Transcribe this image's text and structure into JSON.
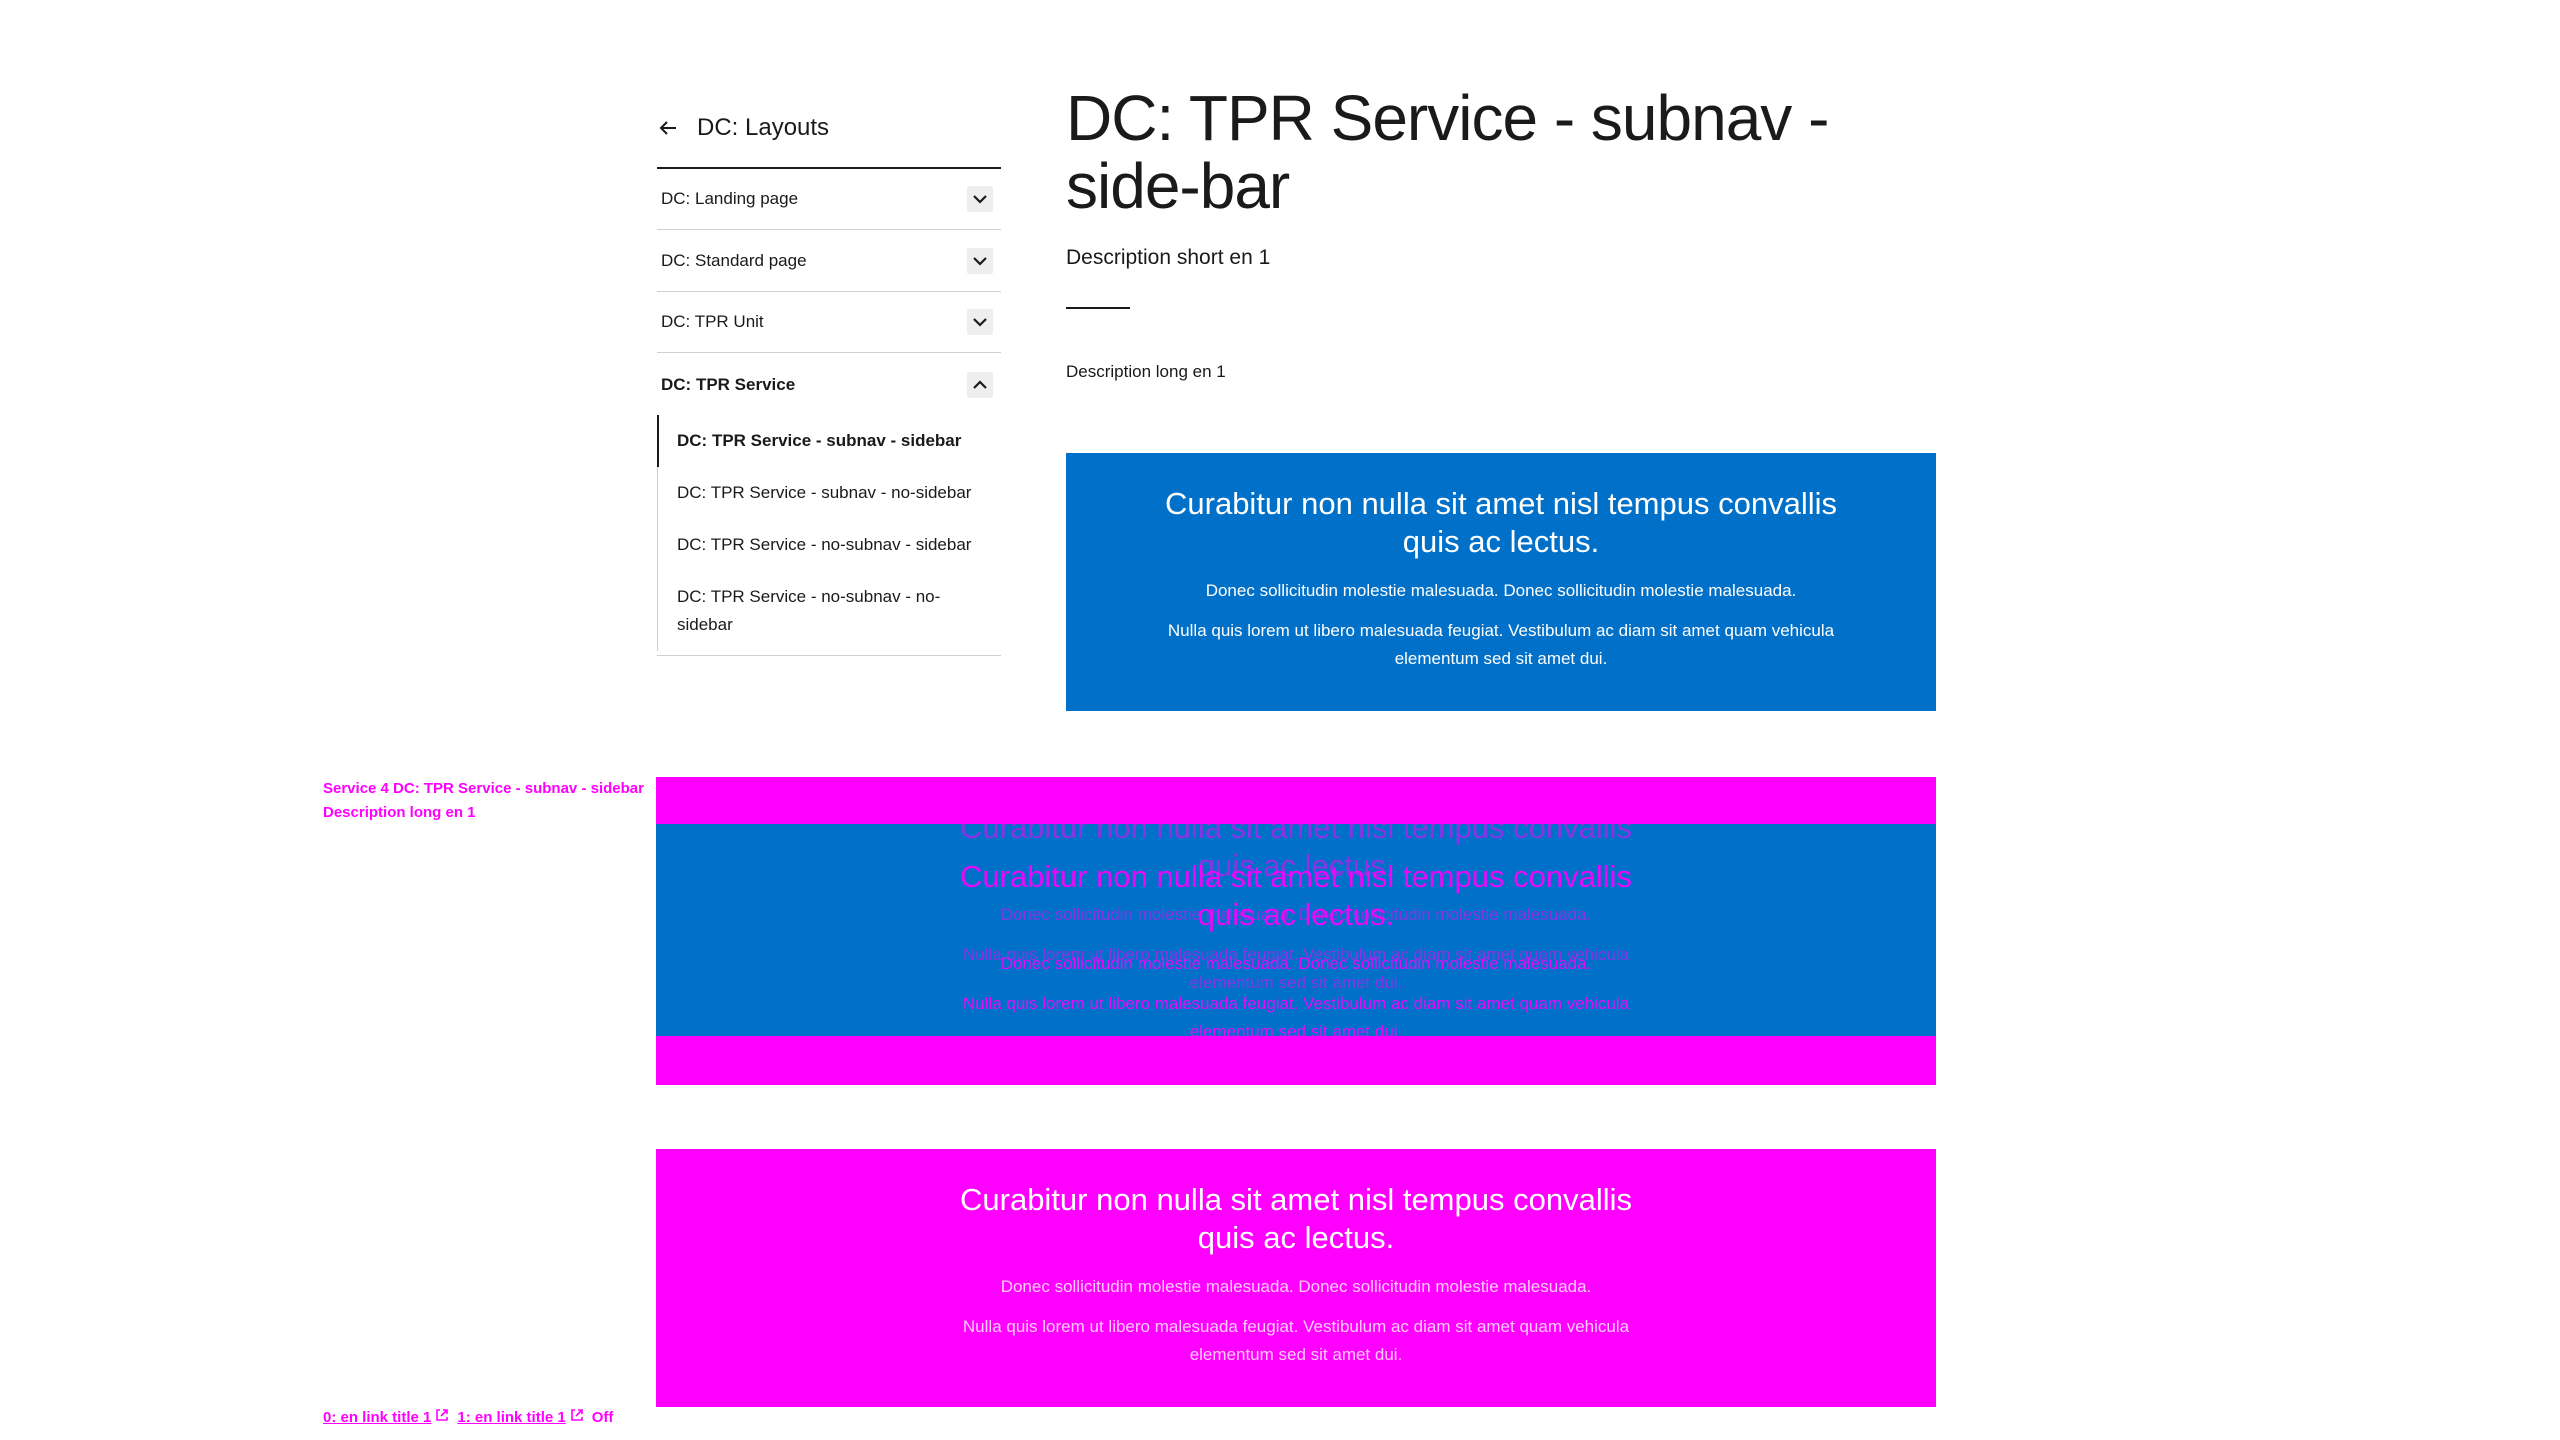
{
  "sidebar": {
    "back_label": "DC: Layouts",
    "sections": [
      {
        "label": "DC: Landing page",
        "open": false
      },
      {
        "label": "DC: Standard page",
        "open": false
      },
      {
        "label": "DC: TPR Unit",
        "open": false
      },
      {
        "label": "DC: TPR Service",
        "open": true
      }
    ],
    "subitems": [
      {
        "label": "DC: TPR Service - subnav - sidebar",
        "active": true
      },
      {
        "label": "DC: TPR Service - subnav - no-sidebar",
        "active": false
      },
      {
        "label": "DC: TPR Service - no-subnav - sidebar",
        "active": false
      },
      {
        "label": "DC: TPR Service - no-subnav - no-sidebar",
        "active": false
      }
    ]
  },
  "main": {
    "title": "DC: TPR Service - subnav - side-bar",
    "description_short": "Description short en 1",
    "description_long": "Description long en 1"
  },
  "promo": {
    "heading": "Curabitur non nulla sit amet nisl tempus convallis quis ac lectus.",
    "para1": "Donec sollicitudin molestie malesuada. Donec sollicitudin molestie malesuada.",
    "para2": "Nulla quis lorem ut libero malesuada feugiat. Vestibulum ac diam sit amet quam vehicula elementum sed sit amet dui."
  },
  "debug": {
    "service_line": "Service 4 DC: TPR Service - subnav - sidebar",
    "description_line": "Description long en 1",
    "links": [
      "0: en link title 1",
      "1: en link title 1"
    ],
    "status": "Off"
  },
  "colors": {
    "promo_blue": "#0070c9",
    "debug_magenta": "#ff00ff",
    "text": "#1a1a1a"
  }
}
